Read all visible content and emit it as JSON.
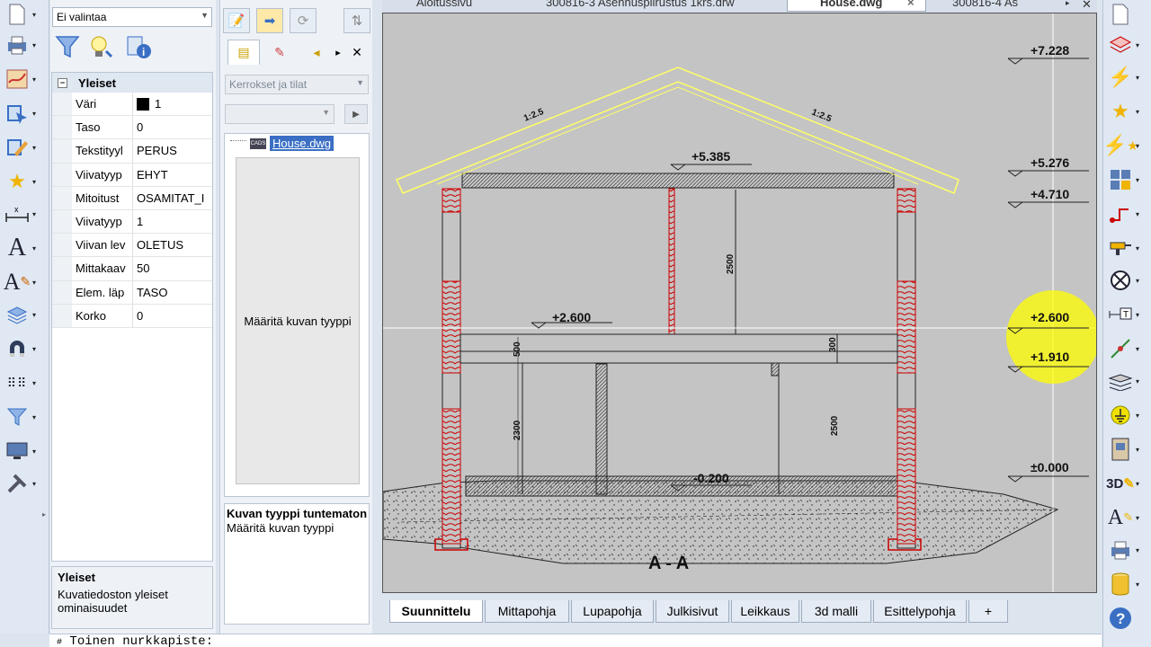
{
  "selection": {
    "value": "Ei valintaa"
  },
  "properties": {
    "group_title": "Yleiset",
    "rows": [
      {
        "key": "Väri",
        "value": "1",
        "swatch": "#000000"
      },
      {
        "key": "Taso",
        "value": "0"
      },
      {
        "key": "Tekstityyl",
        "value": "PERUS"
      },
      {
        "key": "Viivatyyp",
        "value": "EHYT"
      },
      {
        "key": "Mitoitust",
        "value": "OSAMITAT_I"
      },
      {
        "key": "Viivatyyp",
        "value": "1"
      },
      {
        "key": "Viivan lev",
        "value": "OLETUS"
      },
      {
        "key": "Mittakaav",
        "value": "50"
      },
      {
        "key": "Elem. läp",
        "value": "TASO"
      },
      {
        "key": "Korko",
        "value": "0"
      }
    ],
    "description_title": "Yleiset",
    "description_text": "Kuvatiedoston yleiset ominaisuudet"
  },
  "layers_panel": {
    "combo_placeholder": "Kerrokset ja tilat",
    "tree_item": "House.dwg",
    "file_badge": "CADS",
    "preview_text": "Määritä kuvan tyyppi",
    "info_title": "Kuvan tyyppi tuntematon",
    "info_text": "Määritä kuvan tyyppi"
  },
  "doc_tabs": [
    {
      "label": "Aloitussivu",
      "active": false
    },
    {
      "label": "300816-3 Asennuspiirustus 1krs.drw",
      "active": false
    },
    {
      "label": "House.dwg",
      "active": true,
      "close": "×"
    },
    {
      "label": "300816-4 As",
      "active": false
    }
  ],
  "drawing": {
    "title": "A - A",
    "levels_right": [
      "+7.228",
      "+5.276",
      "+4.710",
      "+2.600",
      "+1.910",
      "±0.000"
    ],
    "levels_inside": [
      "+5.385",
      "+2.600",
      "-0.200"
    ],
    "dims": [
      "2500",
      "500",
      "2300",
      "2500",
      "300"
    ],
    "slopes": [
      "1:2.5",
      "1:2.5"
    ]
  },
  "bottom_tabs": [
    "Suunnittelu",
    "Mittapohja",
    "Lupapohja",
    "Julkisivut",
    "Leikkaus",
    "3d malli",
    "Esittelypohja",
    "+"
  ],
  "command": {
    "prompt": "Toinen nurkkapiste:"
  },
  "colors": {
    "accent": "#3a6fc4",
    "highlight": "#ffff00",
    "roof": "#ffff66",
    "wall_red": "#cc0000"
  }
}
